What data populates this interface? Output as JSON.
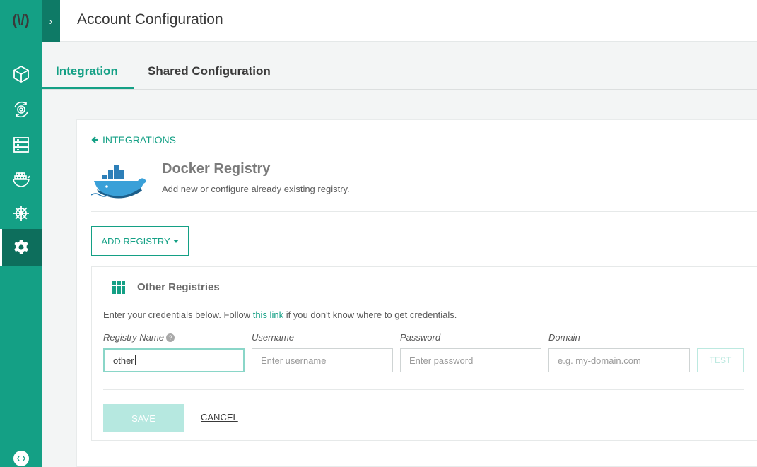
{
  "app": {
    "logo_text": "(\\/)",
    "title": "Account Configuration"
  },
  "sidebar": {
    "items": [
      {
        "icon": "cube-icon"
      },
      {
        "icon": "deploy-cycle-icon"
      },
      {
        "icon": "servers-icon"
      },
      {
        "icon": "docker-icon"
      },
      {
        "icon": "helm-wheel-icon"
      },
      {
        "icon": "gear-icon",
        "active": true
      }
    ]
  },
  "tabs": [
    {
      "label": "Integration",
      "active": true
    },
    {
      "label": "Shared Configuration",
      "active": false
    }
  ],
  "integration": {
    "back_label": "INTEGRATIONS",
    "name": "Docker Registry",
    "description": "Add new or configure already existing registry.",
    "add_button": "ADD REGISTRY"
  },
  "panel": {
    "title": "Other Registries",
    "instructions_pre": "Enter your credentials below. Follow ",
    "instructions_link": "this link",
    "instructions_post": " if you don't know where to get credentials.",
    "fields": {
      "registry_name": {
        "label": "Registry Name",
        "value": "other"
      },
      "username": {
        "label": "Username",
        "placeholder": "Enter username"
      },
      "password": {
        "label": "Password",
        "placeholder": "Enter password"
      },
      "domain": {
        "label": "Domain",
        "placeholder": "e.g. my-domain.com"
      }
    },
    "test_label": "TEST",
    "save_label": "SAVE",
    "cancel_label": "CANCEL"
  },
  "colors": {
    "brand": "#14a085",
    "brand_dark": "#0d6e5c",
    "save_disabled": "#b6e8e0"
  }
}
